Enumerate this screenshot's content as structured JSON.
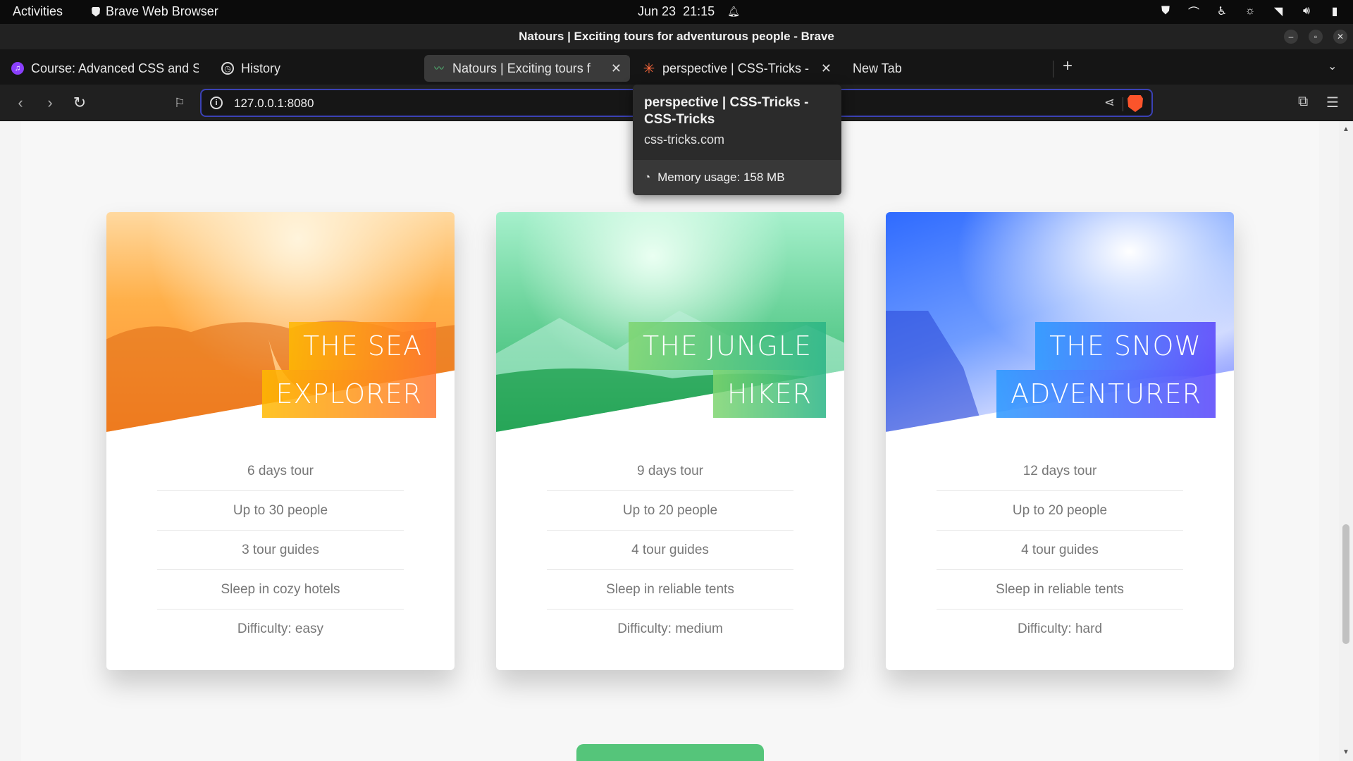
{
  "system": {
    "activities": "Activities",
    "app_name": "Brave Web Browser",
    "date": "Jun 23",
    "time": "21:15"
  },
  "window": {
    "title": "Natours | Exciting tours for adventurous people - Brave"
  },
  "tabs": [
    {
      "label": "Course: Advanced CSS and S",
      "favicon": "course-icon",
      "active": false
    },
    {
      "label": "History",
      "favicon": "history-icon",
      "active": false
    },
    {
      "label": "Natours | Exciting tours f",
      "favicon": "natours-icon",
      "active": true
    },
    {
      "label": "perspective | CSS-Tricks -",
      "favicon": "css-tricks-icon",
      "active": false
    },
    {
      "label": "New Tab",
      "favicon": "",
      "active": false
    }
  ],
  "toolbar": {
    "url": "127.0.0.1:8080"
  },
  "tooltip": {
    "title": "perspective | CSS-Tricks - CSS-Tricks",
    "host": "css-tricks.com",
    "memory": "Memory usage: 158 MB"
  },
  "cards": [
    {
      "title_line1": "THE SEA",
      "title_line2": "EXPLORER",
      "details": [
        "6 days tour",
        "Up to 30 people",
        "3 tour guides",
        "Sleep in cozy hotels",
        "Difficulty: easy"
      ]
    },
    {
      "title_line1": "THE JUNGLE",
      "title_line2": "HIKER",
      "details": [
        "9 days tour",
        "Up to 20 people",
        "4 tour guides",
        "Sleep in reliable tents",
        "Difficulty: medium"
      ]
    },
    {
      "title_line1": "THE SNOW",
      "title_line2": "ADVENTURER",
      "details": [
        "12 days tour",
        "Up to 20 people",
        "4 tour guides",
        "Sleep in reliable tents",
        "Difficulty: hard"
      ]
    }
  ],
  "colors": {
    "brand_green": "#55c57a",
    "orange_start": "#ffb900",
    "orange_end": "#ff7730",
    "green_start": "#7ed56f",
    "green_end": "#28b485",
    "blue_start": "#2998ff",
    "blue_end": "#5643fa"
  }
}
